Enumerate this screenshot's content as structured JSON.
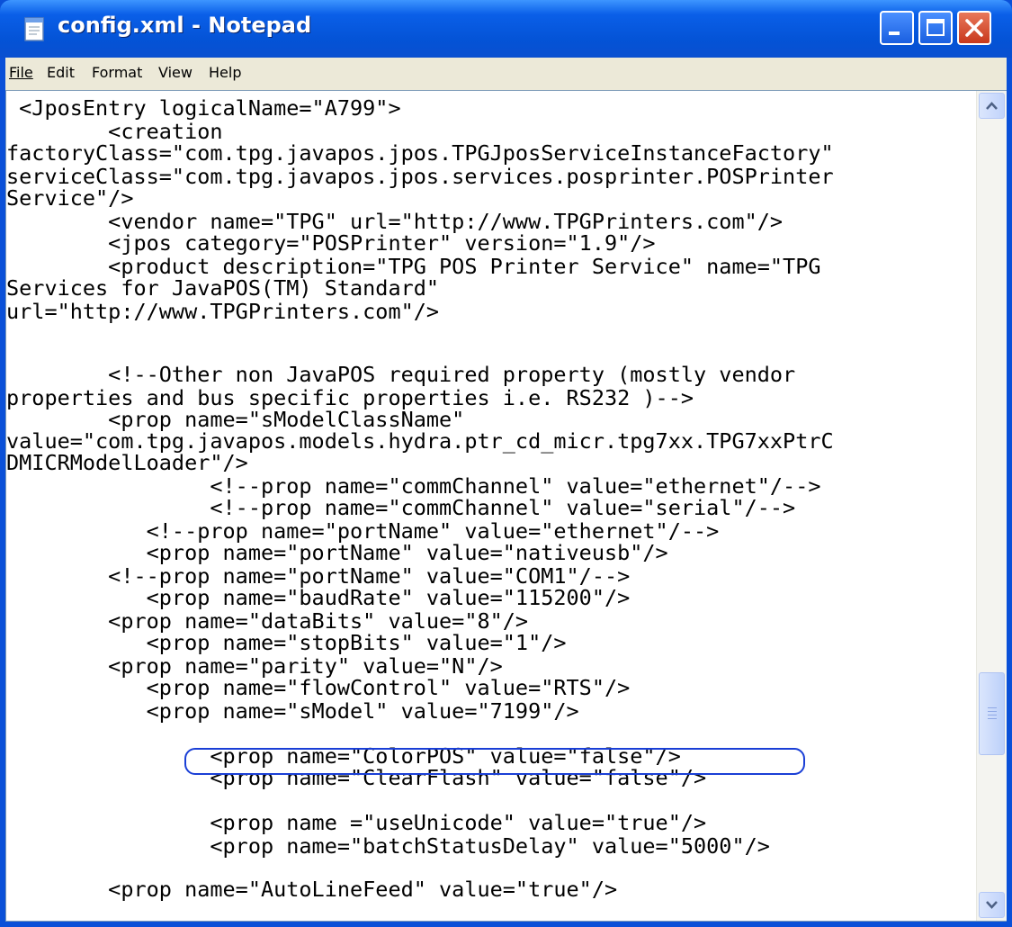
{
  "window": {
    "title": "config.xml - Notepad",
    "title_icon": "notepad-icon"
  },
  "menu": {
    "file": "File",
    "edit": "Edit",
    "format": "Format",
    "view": "View",
    "help": "Help"
  },
  "editor": {
    "lines": [
      " <JposEntry logicalName=\"A799\">",
      "        <creation",
      "factoryClass=\"com.tpg.javapos.jpos.TPGJposServiceInstanceFactory\"",
      "serviceClass=\"com.tpg.javapos.jpos.services.posprinter.POSPrinter",
      "Service\"/>",
      "        <vendor name=\"TPG\" url=\"http://www.TPGPrinters.com\"/>",
      "        <jpos category=\"POSPrinter\" version=\"1.9\"/>",
      "        <product description=\"TPG POS Printer Service\" name=\"TPG",
      "Services for JavaPOS(TM) Standard\"",
      "url=\"http://www.TPGPrinters.com\"/>",
      "",
      "        <!--Other non JavaPOS required property (mostly vendor",
      "properties and bus specific properties i.e. RS232 )-->",
      "        <prop name=\"sModelClassName\"",
      "value=\"com.tpg.javapos.models.hydra.ptr_cd_micr.tpg7xx.TPG7xxPtrC",
      "DMICRModelLoader\"/>",
      "                <!--prop name=\"commChannel\" value=\"ethernet\"/-->",
      "                <!--prop name=\"commChannel\" value=\"serial\"/-->",
      "           <!--prop name=\"portName\" value=\"ethernet\"/-->",
      "           <prop name=\"portName\" value=\"nativeusb\"/>",
      "        <!--prop name=\"portName\" value=\"COM1\"/-->",
      "           <prop name=\"baudRate\" value=\"115200\"/>",
      "        <prop name=\"dataBits\" value=\"8\"/>",
      "           <prop name=\"stopBits\" value=\"1\"/>",
      "        <prop name=\"parity\" value=\"N\"/>",
      "           <prop name=\"flowControl\" value=\"RTS\"/>",
      "           <prop name=\"sModel\" value=\"7199\"/>",
      "",
      "                <prop name=\"ColorPOS\" value=\"false\"/>",
      "                <prop name=\"ClearFlash\" value=\"false\"/>",
      "",
      "                <prop name =\"useUnicode\" value=\"true\"/>",
      "                <prop name=\"batchStatusDelay\" value=\"5000\"/>",
      "",
      "        <prop name=\"AutoLineFeed\" value=\"true\"/>"
    ]
  },
  "colors": {
    "titlebar": "#0453d6",
    "menubar": "#ece9d8",
    "highlight_ring": "#1a3fd6",
    "close_button": "#c8381c"
  }
}
